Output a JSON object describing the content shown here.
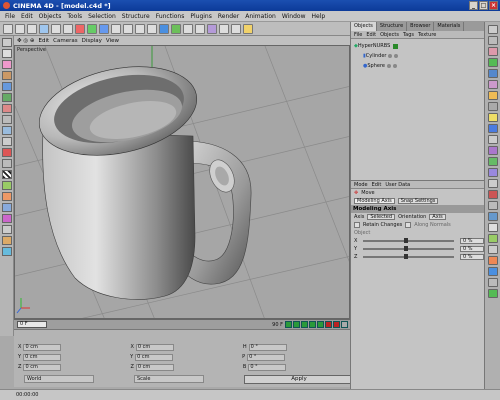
{
  "window": {
    "title": "CINEMA 4D - [model.c4d *]"
  },
  "menu": [
    "File",
    "Edit",
    "Objects",
    "Tools",
    "Selection",
    "Structure",
    "Functions",
    "Plugins",
    "Render",
    "Animation",
    "Window",
    "Help"
  ],
  "viewport": {
    "menu": [
      "Edit",
      "Cameras",
      "Display",
      "View"
    ],
    "label": "Perspective"
  },
  "timeline": {
    "current_frame": "0 F",
    "end_frame": "90 F"
  },
  "coordinates": {
    "rows": [
      {
        "pos_label": "X",
        "pos_value": "0 cm",
        "size_label": "X",
        "size_value": "0 cm",
        "rot_label": "H",
        "rot_value": "0 °"
      },
      {
        "pos_label": "Y",
        "pos_value": "0 cm",
        "size_label": "Y",
        "size_value": "0 cm",
        "rot_label": "P",
        "rot_value": "0 °"
      },
      {
        "pos_label": "Z",
        "pos_value": "0 cm",
        "size_label": "Z",
        "size_value": "0 cm",
        "rot_label": "B",
        "rot_value": "0 °"
      }
    ],
    "mode_select": "World",
    "scale_select": "Scale",
    "apply_label": "Apply"
  },
  "status": {
    "time": "00:00:00"
  },
  "object_manager": {
    "tabs": [
      "Objects",
      "Structure",
      "Browser",
      "Materials"
    ],
    "menu": [
      "File",
      "Edit",
      "Objects",
      "Tags",
      "Texture"
    ],
    "items": [
      {
        "name": "HyperNURBS",
        "level": 0
      },
      {
        "name": "Cylinder",
        "level": 1
      },
      {
        "name": "Sphere",
        "level": 1
      }
    ]
  },
  "attribute_manager": {
    "menu": [
      "Mode",
      "Edit",
      "User Data"
    ],
    "tool_name": "Move",
    "tabs": [
      "Modeling Axis",
      "Snap Settings"
    ],
    "section_title": "Modeling Axis",
    "axis_label": "Axis",
    "axis_value": "Selected",
    "orientation_label": "Orientation",
    "orientation_value": "Axis",
    "retain_label": "Retain Changes",
    "normals_label": "Along Normals",
    "object_label": "Object",
    "sliders": [
      {
        "label": "X",
        "value": "0 %"
      },
      {
        "label": "Y",
        "value": "0 %"
      },
      {
        "label": "Z",
        "value": "0 %"
      }
    ]
  },
  "colors": {
    "titlebar": "#1b4fb0",
    "viewport_bg": "#a6a6a6",
    "panel_bg": "#c4c4c4"
  }
}
